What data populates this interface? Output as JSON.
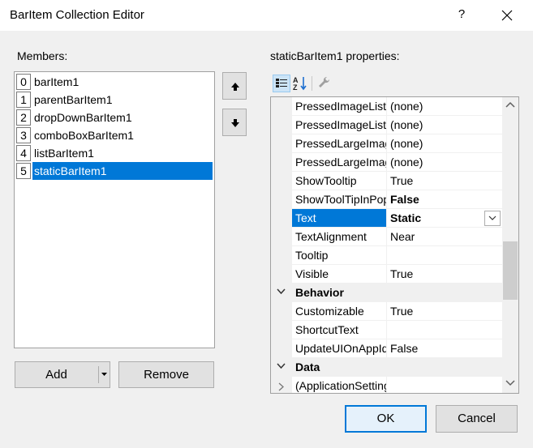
{
  "window": {
    "title": "BarItem Collection Editor",
    "help_glyph": "?"
  },
  "members": {
    "label": "Members:",
    "items": [
      {
        "index": "0",
        "name": "barItem1"
      },
      {
        "index": "1",
        "name": "parentBarItem1"
      },
      {
        "index": "2",
        "name": "dropDownBarItem1"
      },
      {
        "index": "3",
        "name": "comboBoxBarItem1"
      },
      {
        "index": "4",
        "name": "listBarItem1"
      },
      {
        "index": "5",
        "name": "staticBarItem1"
      }
    ],
    "selected_index": 5
  },
  "buttons": {
    "add": "Add",
    "remove": "Remove",
    "ok": "OK",
    "cancel": "Cancel"
  },
  "properties": {
    "label": "staticBarItem1 properties:",
    "rows": [
      {
        "name": "PressedImageList",
        "value": "(none)"
      },
      {
        "name": "PressedImageList",
        "value": "(none)"
      },
      {
        "name": "PressedLargeImage",
        "value": "(none)"
      },
      {
        "name": "PressedLargeImage",
        "value": "(none)"
      },
      {
        "name": "ShowTooltip",
        "value": "True"
      },
      {
        "name": "ShowToolTipInPopup",
        "value": "False"
      },
      {
        "name": "Text",
        "value": "Static"
      },
      {
        "name": "TextAlignment",
        "value": "Near"
      },
      {
        "name": "Tooltip",
        "value": ""
      },
      {
        "name": "Visible",
        "value": "True"
      },
      {
        "name": "Behavior",
        "value": ""
      },
      {
        "name": "Customizable",
        "value": "True"
      },
      {
        "name": "ShortcutText",
        "value": ""
      },
      {
        "name": "UpdateUIOnAppIdle",
        "value": "False"
      },
      {
        "name": "Data",
        "value": ""
      },
      {
        "name": "(ApplicationSettings)",
        "value": ""
      }
    ],
    "selected_row": "Text"
  },
  "colors": {
    "accent": "#0078d7",
    "dialog_bg": "#f0f0f0"
  }
}
